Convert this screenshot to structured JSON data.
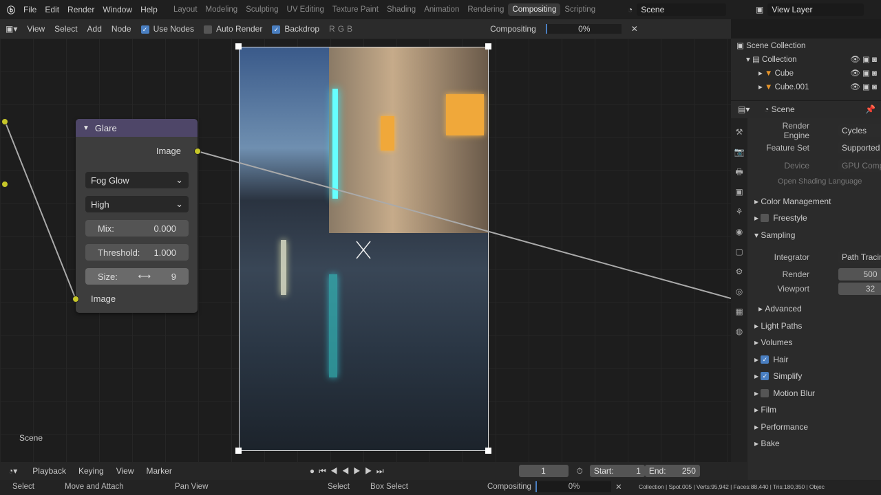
{
  "topbar": {
    "menus": [
      "File",
      "Edit",
      "Render",
      "Window",
      "Help"
    ],
    "workspaces": [
      "Layout",
      "Modeling",
      "Sculpting",
      "UV Editing",
      "Texture Paint",
      "Shading",
      "Animation",
      "Rendering",
      "Compositing",
      "Scripting"
    ],
    "active_workspace": "Compositing",
    "scene": "Scene",
    "view_layer": "View Layer"
  },
  "header": {
    "menus": [
      "View",
      "Select",
      "Add",
      "Node"
    ],
    "use_nodes": "Use Nodes",
    "auto_render": "Auto Render",
    "backdrop": "Backdrop",
    "channels": [
      "R",
      "G",
      "B"
    ],
    "job": "Compositing",
    "progress": "0%"
  },
  "node": {
    "title": "Glare",
    "output": "Image",
    "glare_type": "Fog Glow",
    "quality": "High",
    "mix_label": "Mix:",
    "mix": "0.000",
    "threshold_label": "Threshold:",
    "threshold": "1.000",
    "size_label": "Size:",
    "size": "9",
    "input": "Image"
  },
  "editor": {
    "scene_label": "Scene"
  },
  "outliner": {
    "root": "Scene Collection",
    "collection": "Collection",
    "items": [
      "Cube",
      "Cube.001"
    ]
  },
  "properties": {
    "context": "Scene",
    "render_engine_label": "Render Engine",
    "render_engine": "Cycles",
    "feature_set_label": "Feature Set",
    "feature_set": "Supported",
    "device_label": "Device",
    "device": "GPU Compute",
    "osl": "Open Shading Language",
    "color_management": "Color Management",
    "freestyle": "Freestyle",
    "sampling": "Sampling",
    "integrator_label": "Integrator",
    "integrator": "Path Tracing",
    "render_label": "Render",
    "render": "500",
    "viewport_label": "Viewport",
    "viewport": "32",
    "advanced": "Advanced",
    "light_paths": "Light Paths",
    "volumes": "Volumes",
    "hair": "Hair",
    "simplify": "Simplify",
    "motion_blur": "Motion Blur",
    "film": "Film",
    "performance": "Performance",
    "bake": "Bake"
  },
  "timeline": {
    "menus": [
      "Playback",
      "Keying",
      "View",
      "Marker"
    ],
    "frame": "1",
    "start_label": "Start:",
    "start": "1",
    "end_label": "End:",
    "end": "250"
  },
  "status": {
    "select": "Select",
    "move": "Move and Attach",
    "pan": "Pan View",
    "select2": "Select",
    "box": "Box Select",
    "job": "Compositing",
    "progress": "0%",
    "stats": "Collection | Spot.005 | Verts:95,942 | Faces:88,440 | Tris:180,350 | Objec"
  },
  "colors": {
    "node_header": "#4e4668",
    "socket": "#c7c729",
    "accent": "#4a7fc1"
  }
}
